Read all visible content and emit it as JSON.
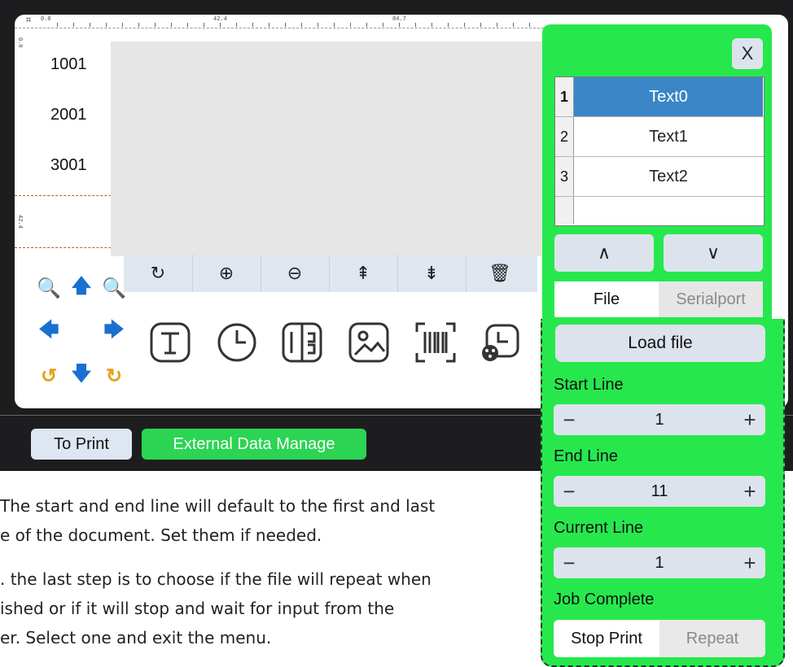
{
  "ruler": {
    "origin": "0.0",
    "mark1": "42.4",
    "mark2": "84.7",
    "left_origin": "0.0",
    "left_mark": "42.4"
  },
  "lines": [
    "1001",
    "2001",
    "3001"
  ],
  "toolbar": {
    "icons": [
      "rotate-icon",
      "zoom-in-icon",
      "zoom-out-icon",
      "layer-up-icon",
      "layer-down-icon",
      "delete-icon"
    ],
    "rotate": "↻",
    "zoom_in": "⊕",
    "zoom_out": "⊖",
    "layer_up": "⇞",
    "layer_down": "⇟",
    "delete": "🗑"
  },
  "nav": {
    "zoom_out": "🔍",
    "up": "🡅",
    "zoom_in": "🔍",
    "left": "🡄",
    "right": "🡆",
    "rotate_ccw": "↺",
    "down": "🡇",
    "rotate_cw": "↻"
  },
  "insert_icons": [
    "text-icon",
    "clock-icon",
    "serial-number-icon",
    "image-icon",
    "barcode-icon",
    "time-shift-icon"
  ],
  "bottom": {
    "to_print": "To Print",
    "external_data": "External Data Manage"
  },
  "panel": {
    "close": "X",
    "list": [
      {
        "index": "1",
        "name": "Text0",
        "selected": true
      },
      {
        "index": "2",
        "name": "Text1",
        "selected": false
      },
      {
        "index": "3",
        "name": "Text2",
        "selected": false
      }
    ],
    "up": "∧",
    "down": "∨",
    "tabs": {
      "file": "File",
      "serialport": "Serialport"
    },
    "load_file": "Load file",
    "start_line": {
      "label": "Start Line",
      "value": "1"
    },
    "end_line": {
      "label": "End Line",
      "value": "11"
    },
    "current_line": {
      "label": "Current Line",
      "value": "1"
    },
    "minus": "−",
    "plus": "+",
    "job_complete": {
      "label": "Job Complete",
      "stop": "Stop Print",
      "repeat": "Repeat"
    }
  },
  "document": {
    "para1_line1": "The start and end line will default to the first and last",
    "para1_line2": "e of the document. Set them if needed.",
    "para2_line1": ". the last step is to choose if the file will repeat when",
    "para2_line2": "ished or if it will stop and wait for input from the",
    "para2_line3": "er. Select one and exit the menu."
  },
  "colors": {
    "panel_green": "#26e84d",
    "button_green": "#2bd553",
    "selection_blue": "#3a86c6",
    "app_dark": "#1d1d1f"
  }
}
